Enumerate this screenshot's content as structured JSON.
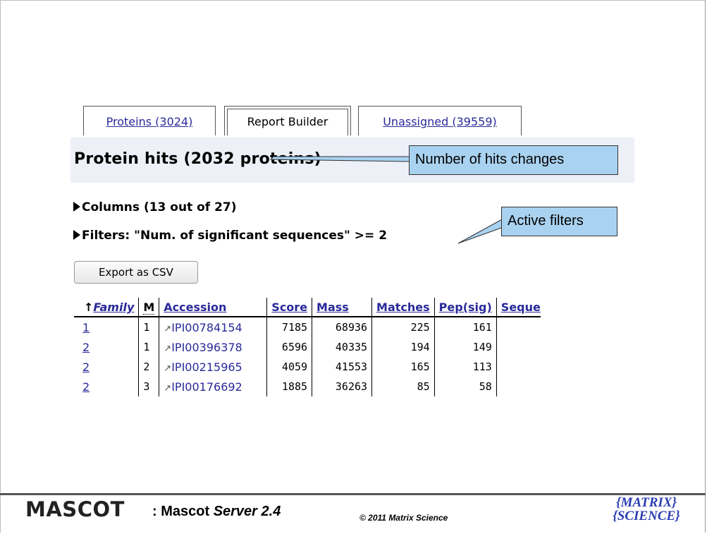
{
  "tabs": [
    {
      "label": "Proteins (3024)"
    },
    {
      "label": "Report Builder"
    },
    {
      "label": "Unassigned (39559)"
    }
  ],
  "page_title": "Protein hits (2032 proteins)",
  "callouts": {
    "hits": "Number of hits changes",
    "filters": "Active filters"
  },
  "columns_toggle": "Columns (13 out of 27)",
  "filters_toggle": "Filters: \"Num. of significant sequences\" >= 2",
  "export_button": "Export as CSV",
  "table": {
    "sort_indicator": "↑",
    "headers": {
      "family": "Family",
      "m": "M",
      "accession": "Accession",
      "score": "Score",
      "mass": "Mass",
      "matches": "Matches",
      "pep_sig": "Pep(sig)",
      "seque": "Seque"
    },
    "rows": [
      {
        "family": "1",
        "m": "1",
        "accession": "IPI00784154",
        "score": "7185",
        "mass": "68936",
        "matches": "225",
        "pep_sig": "161"
      },
      {
        "family": "2",
        "m": "1",
        "accession": "IPI00396378",
        "score": "6596",
        "mass": "40335",
        "matches": "194",
        "pep_sig": "149"
      },
      {
        "family": "2",
        "m": "2",
        "accession": "IPI00215965",
        "score": "4059",
        "mass": "41553",
        "matches": "165",
        "pep_sig": "113"
      },
      {
        "family": "2",
        "m": "3",
        "accession": "IPI00176692",
        "score": "1885",
        "mass": "36263",
        "matches": "85",
        "pep_sig": "58"
      }
    ]
  },
  "footer": {
    "brand": "MASCOT",
    "product_prefix": ": Mascot ",
    "product_name": "Server 2.4",
    "copyright": "© 2011 Matrix Science",
    "logo_line1": "{MATRIX}",
    "logo_line2": "{SCIENCE}"
  },
  "colors": {
    "link": "#2a2a9a",
    "callout_fill": "#a9d2f0",
    "header_band": "#eef0f8",
    "logo": "#2a3db0"
  }
}
